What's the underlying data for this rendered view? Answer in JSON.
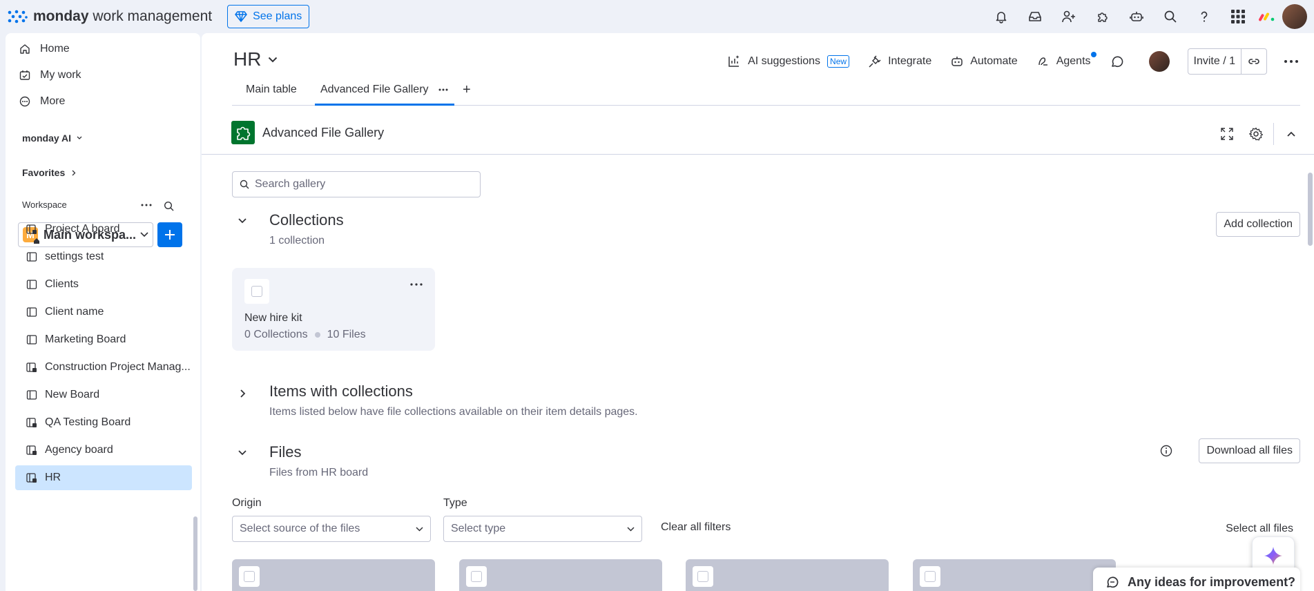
{
  "topbar": {
    "brand_bold": "monday",
    "brand_rest": " work management",
    "see_plans": "See plans",
    "icons": [
      "bell-icon",
      "inbox-icon",
      "invite-members-icon",
      "apps-icon",
      "robot-icon",
      "search-icon",
      "help-icon",
      "app-switcher-icon"
    ]
  },
  "sidebar": {
    "nav": [
      {
        "label": "Home",
        "icon": "home-icon"
      },
      {
        "label": "My work",
        "icon": "calendar-check-icon"
      },
      {
        "label": "More",
        "icon": "more-circle-icon"
      }
    ],
    "monday_ai": "monday AI",
    "favorites": "Favorites",
    "workspace_label": "Workspace",
    "workspace": {
      "badge": "M",
      "name": "Main workspa..."
    },
    "boards": [
      {
        "label": "Project A board",
        "locked": true
      },
      {
        "label": "settings test",
        "locked": false
      },
      {
        "label": "Clients",
        "locked": false
      },
      {
        "label": "Client name",
        "locked": false
      },
      {
        "label": "Marketing Board",
        "locked": false
      },
      {
        "label": "Construction Project Manag...",
        "locked": true
      },
      {
        "label": "New Board",
        "locked": false
      },
      {
        "label": "QA Testing Board",
        "locked": true
      },
      {
        "label": "Agency board",
        "locked": true
      },
      {
        "label": "HR",
        "locked": true,
        "active": true
      }
    ]
  },
  "board": {
    "title": "HR",
    "actions": {
      "ai_suggestions": "AI suggestions",
      "new_badge": "New",
      "integrate": "Integrate",
      "automate": "Automate",
      "agents": "Agents",
      "invite": "Invite / 1"
    },
    "tabs": [
      {
        "label": "Main table"
      },
      {
        "label": "Advanced File Gallery",
        "active": true
      }
    ],
    "add_tab": "+"
  },
  "app": {
    "title": "Advanced File Gallery",
    "search_placeholder": "Search gallery",
    "collections": {
      "title": "Collections",
      "subtitle": "1 collection",
      "add_button": "Add collection",
      "card": {
        "name": "New hire kit",
        "collections": "0 Collections",
        "files": "10 Files"
      }
    },
    "items_with_collections": {
      "title": "Items with collections",
      "subtitle": "Items listed below have file collections available on their item details pages."
    },
    "files": {
      "title": "Files",
      "subtitle": "Files from HR board",
      "download_all": "Download all files",
      "origin_label": "Origin",
      "origin_placeholder": "Select source of the files",
      "type_label": "Type",
      "type_placeholder": "Select type",
      "clear_filters": "Clear all filters",
      "select_all": "Select all files",
      "cards_visible": 4
    }
  },
  "feedback": "Any ideas for improvement?",
  "colors": {
    "accent": "#0073ea",
    "app_icon": "#00752e",
    "active_item": "#cce5ff",
    "workspace_badge": "#fdab3d"
  }
}
